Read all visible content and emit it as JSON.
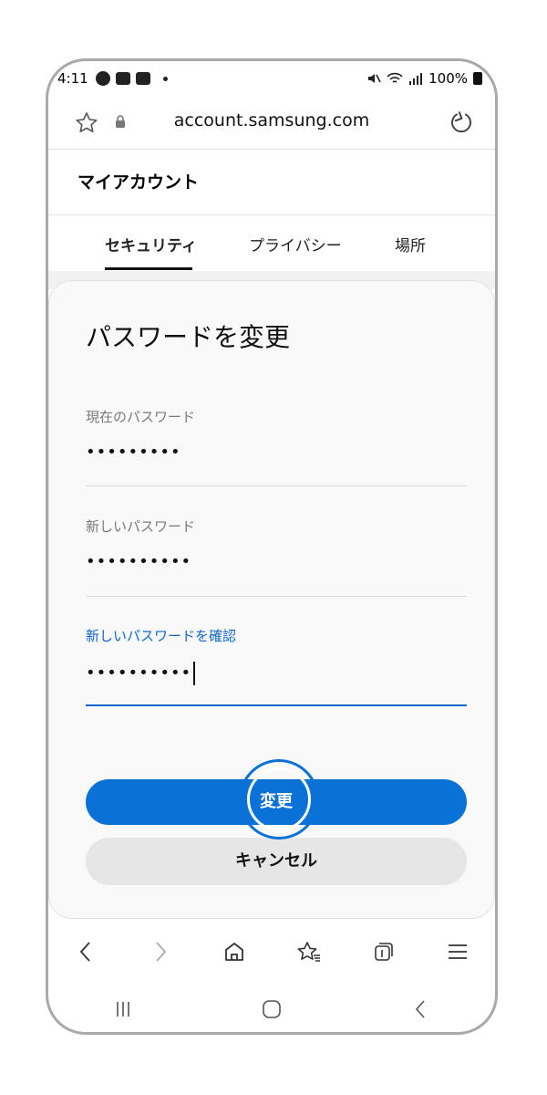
{
  "status_bar": {
    "time": "4:11",
    "battery_text": "100%"
  },
  "browser": {
    "url": "account.samsung.com"
  },
  "account": {
    "title": "マイアカウント"
  },
  "tabs": [
    {
      "label": "セキュリティ",
      "active": true
    },
    {
      "label": "プライバシー",
      "active": false
    },
    {
      "label": "場所",
      "active": false
    }
  ],
  "form": {
    "heading": "パスワードを変更",
    "fields": [
      {
        "label": "現在のパスワード",
        "value": "•••••••••"
      },
      {
        "label": "新しいパスワード",
        "value": "••••••••••"
      },
      {
        "label": "新しいパスワードを確認",
        "value": "••••••••••",
        "focused": true
      }
    ],
    "submit_label": "変更",
    "cancel_label": "キャンセル"
  },
  "icons": {
    "favorite": "star-outline-icon",
    "lock": "lock-icon",
    "reload": "reload-icon",
    "back": "chevron-left-icon",
    "forward": "chevron-right-icon",
    "home": "home-icon",
    "bookmarks": "bookmark-star-icon",
    "tabs": "tabs-icon",
    "menu": "hamburger-menu-icon",
    "recents": "recents-icon",
    "home_nav": "home-nav-icon",
    "back_nav": "back-nav-icon"
  },
  "colors": {
    "accent": "#0a72d6",
    "secondary_button": "#e6e6e6",
    "card_bg": "#f9f9f9"
  }
}
